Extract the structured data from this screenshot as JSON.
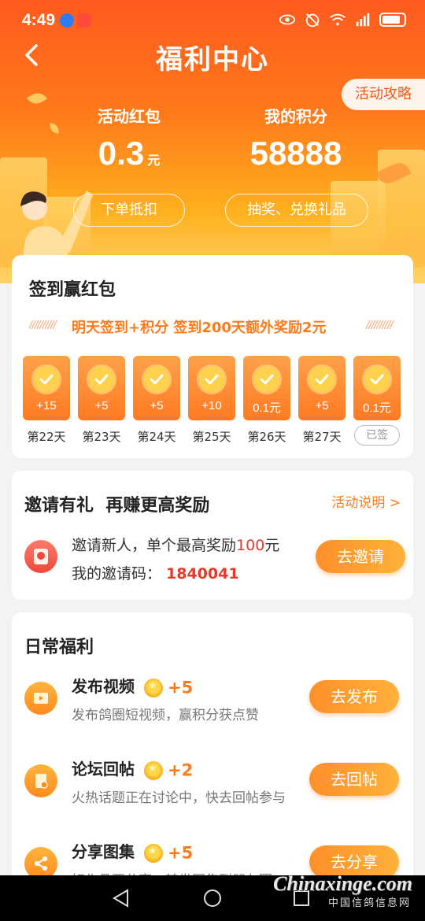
{
  "status": {
    "time": "4:49"
  },
  "header": {
    "title": "福利中心",
    "guide_button": "活动攻略"
  },
  "stats": {
    "red_packet_label": "活动红包",
    "red_packet_value": "0.3",
    "red_packet_unit": "元",
    "red_packet_button": "下单抵扣",
    "points_label": "我的积分",
    "points_value": "58888",
    "points_button": "抽奖、兑换礼品"
  },
  "signin": {
    "title": "签到赢红包",
    "ticker": "明天签到+积分 签到200天额外奖励2元",
    "days": [
      {
        "value": "+15",
        "label": "第22天"
      },
      {
        "value": "+5",
        "label": "第23天"
      },
      {
        "value": "+5",
        "label": "第24天"
      },
      {
        "value": "+10",
        "label": "第25天"
      },
      {
        "value": "0.1元",
        "label": "第26天"
      },
      {
        "value": "+5",
        "label": "第27天"
      },
      {
        "value": "0.1元",
        "label": "已签"
      }
    ]
  },
  "invite": {
    "title": "邀请有礼  再赚更高奖励",
    "rules_link": "活动说明 >",
    "line1_prefix": "邀请新人，单个最高奖励",
    "line1_amount": "100",
    "line1_suffix": "元",
    "code_label": "我的邀请码：",
    "code": "1840041",
    "button": "去邀请"
  },
  "daily": {
    "title": "日常福利",
    "tasks": [
      {
        "title": "发布视频",
        "reward": "+5",
        "desc": "发布鸽圈短视频，赢积分获点赞",
        "button": "去发布",
        "icon": "video-icon"
      },
      {
        "title": "论坛回帖",
        "reward": "+2",
        "desc": "火热话题正在讨论中，快去回帖参与",
        "button": "去回帖",
        "icon": "reply-icon"
      },
      {
        "title": "分享图集",
        "reward": "+5",
        "desc": "好作品要分享，转发图集到朋友圈",
        "button": "去分享",
        "icon": "share-icon"
      }
    ]
  },
  "watermark": {
    "site": "Chinaxinge.com",
    "name": "中国信鸽信息网"
  },
  "colors": {
    "accent": "#ff7a1a",
    "red": "#e8392b"
  }
}
